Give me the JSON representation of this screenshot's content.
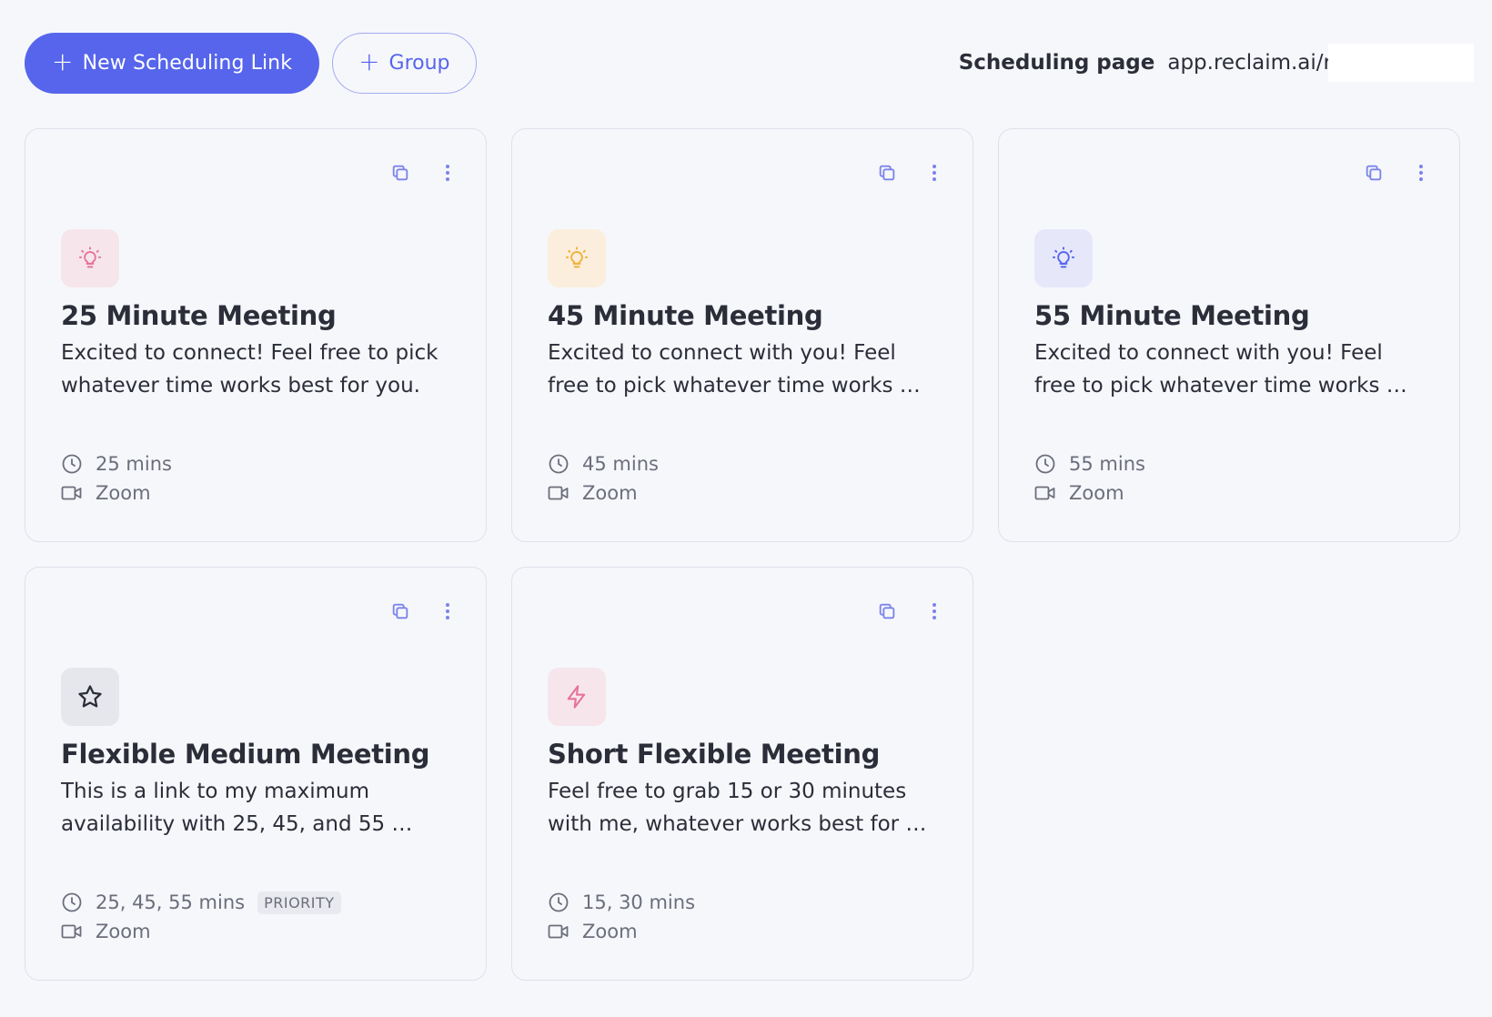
{
  "toolbar": {
    "new_link_label": "New Scheduling Link",
    "group_label": "Group",
    "scheduling_page_label": "Scheduling page",
    "scheduling_page_url": "app.reclaim.ai/r"
  },
  "cards": [
    {
      "title": "25 Minute Meeting",
      "description": "Excited to connect! Feel free to pick whatever time works best for you.",
      "duration": "25 mins",
      "location": "Zoom",
      "icon": "lightbulb-icon",
      "icon_color": "#e8739a",
      "icon_bg": "#f6e6ec"
    },
    {
      "title": "45 Minute Meeting",
      "description": "Excited to connect with you! Feel free to pick whatever time works …",
      "duration": "45 mins",
      "location": "Zoom",
      "icon": "lightbulb-icon",
      "icon_color": "#f0b23a",
      "icon_bg": "#fbeedd"
    },
    {
      "title": "55 Minute Meeting",
      "description": "Excited to connect with you! Feel free to pick whatever time works …",
      "duration": "55 mins",
      "location": "Zoom",
      "icon": "lightbulb-icon",
      "icon_color": "#5665ec",
      "icon_bg": "#e6e8fa"
    },
    {
      "title": "Flexible Medium Meeting",
      "description": "This is a link to my maximum availability with 25, 45, and 55 …",
      "duration": "25, 45, 55 mins",
      "badge": "PRIORITY",
      "location": "Zoom",
      "icon": "star-icon",
      "icon_color": "#2b2d38",
      "icon_bg": "#e6e7ec"
    },
    {
      "title": "Short Flexible Meeting",
      "description": "Feel free to grab 15 or 30 minutes with me, whatever works best for …",
      "duration": "15, 30 mins",
      "location": "Zoom",
      "icon": "lightning-icon",
      "icon_color": "#e8739a",
      "icon_bg": "#f6e6ec"
    }
  ],
  "colors": {
    "accent": "#5665ec",
    "background": "#f6f7fb",
    "card_border": "#dfe1e9",
    "muted_text": "#6b6e7b"
  }
}
